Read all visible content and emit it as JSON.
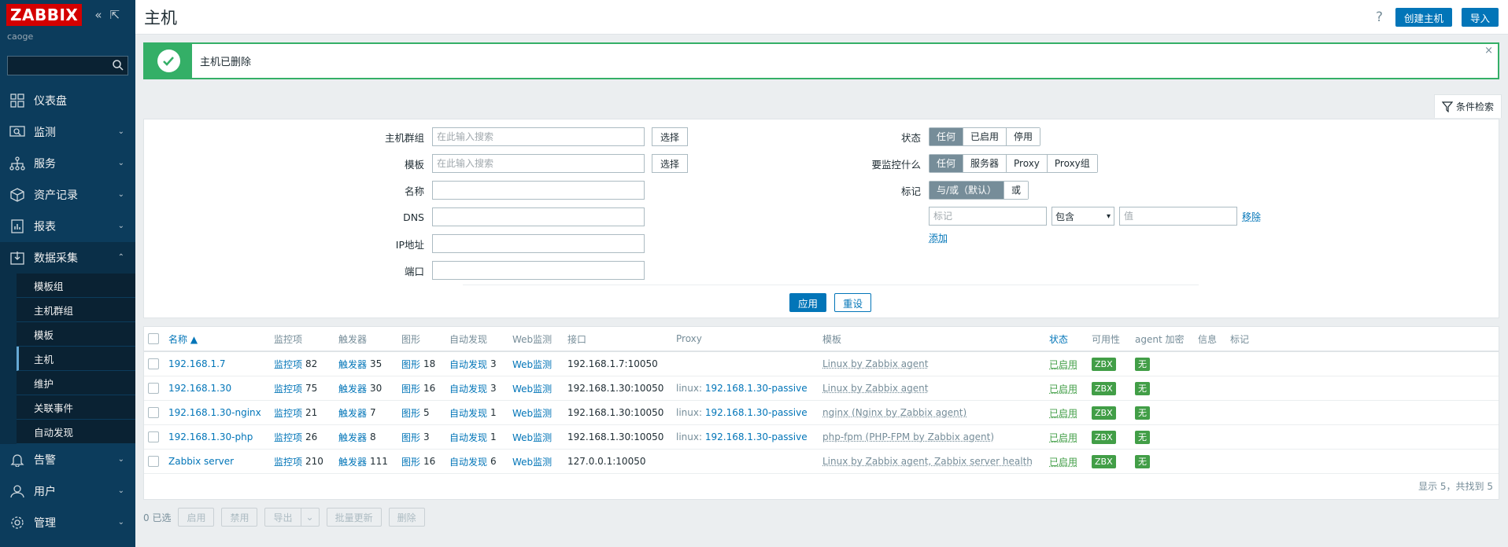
{
  "app": {
    "logo": "ZABBIX",
    "server_name": "caoge"
  },
  "sidebar": {
    "items": [
      {
        "label": "仪表盘",
        "icon": "dashboard-icon"
      },
      {
        "label": "监测",
        "icon": "monitoring-icon"
      },
      {
        "label": "服务",
        "icon": "services-icon"
      },
      {
        "label": "资产记录",
        "icon": "inventory-icon"
      },
      {
        "label": "报表",
        "icon": "reports-icon"
      },
      {
        "label": "数据采集",
        "icon": "data-collection-icon"
      },
      {
        "label": "告警",
        "icon": "alerts-icon"
      },
      {
        "label": "用户",
        "icon": "users-icon"
      },
      {
        "label": "管理",
        "icon": "administration-icon"
      }
    ],
    "submenu": [
      "模板组",
      "主机群组",
      "模板",
      "主机",
      "维护",
      "关联事件",
      "自动发现"
    ],
    "active_sub": "主机"
  },
  "header": {
    "title": "主机",
    "help": "?",
    "create_label": "创建主机",
    "import_label": "导入"
  },
  "alert": {
    "message": "主机已删除",
    "close": "×"
  },
  "filter": {
    "tab_label": "条件检索",
    "host_group_label": "主机群组",
    "template_label": "模板",
    "name_label": "名称",
    "dns_label": "DNS",
    "ip_label": "IP地址",
    "port_label": "端口",
    "placeholder": "在此输入搜索",
    "select_label": "选择",
    "status_label": "状态",
    "status_options": [
      "任何",
      "已启用",
      "停用"
    ],
    "monitored_by_label": "要监控什么",
    "monitored_by_options": [
      "任何",
      "服务器",
      "Proxy",
      "Proxy组"
    ],
    "tags_label": "标记",
    "tags_options": [
      "与/或（默认）",
      "或"
    ],
    "tag_placeholder": "标记",
    "tag_operator": "包含",
    "value_placeholder": "值",
    "remove_label": "移除",
    "add_label": "添加",
    "apply_label": "应用",
    "reset_label": "重设"
  },
  "table": {
    "headers": {
      "name": "名称 ▲",
      "items": "监控项",
      "triggers": "触发器",
      "graphs": "图形",
      "discovery": "自动发现",
      "web": "Web监测",
      "interface": "接口",
      "proxy": "Proxy",
      "templates": "模板",
      "status": "状态",
      "availability": "可用性",
      "agent_encryption": "agent 加密",
      "info": "信息",
      "tags": "标记"
    },
    "rows": [
      {
        "name": "192.168.1.7",
        "items_label": "监控项",
        "items": "82",
        "triggers_label": "触发器",
        "triggers": "35",
        "graphs_label": "图形",
        "graphs": "18",
        "discovery_label": "自动发现",
        "discovery": "3",
        "web": "Web监测",
        "interface": "192.168.1.7:10050",
        "proxy_prefix": "",
        "proxy": "",
        "templates": "Linux by Zabbix agent",
        "status": "已启用",
        "availability": "ZBX",
        "encryption": "无"
      },
      {
        "name": "192.168.1.30",
        "items_label": "监控项",
        "items": "75",
        "triggers_label": "触发器",
        "triggers": "30",
        "graphs_label": "图形",
        "graphs": "16",
        "discovery_label": "自动发现",
        "discovery": "3",
        "web": "Web监测",
        "interface": "192.168.1.30:10050",
        "proxy_prefix": "linux: ",
        "proxy": "192.168.1.30-passive",
        "templates": "Linux by Zabbix agent",
        "status": "已启用",
        "availability": "ZBX",
        "encryption": "无"
      },
      {
        "name": "192.168.1.30-nginx",
        "items_label": "监控项",
        "items": "21",
        "triggers_label": "触发器",
        "triggers": "7",
        "graphs_label": "图形",
        "graphs": "5",
        "discovery_label": "自动发现",
        "discovery": "1",
        "web": "Web监测",
        "interface": "192.168.1.30:10050",
        "proxy_prefix": "linux: ",
        "proxy": "192.168.1.30-passive",
        "templates": "nginx (Nginx by Zabbix agent)",
        "status": "已启用",
        "availability": "ZBX",
        "encryption": "无"
      },
      {
        "name": "192.168.1.30-php",
        "items_label": "监控项",
        "items": "26",
        "triggers_label": "触发器",
        "triggers": "8",
        "graphs_label": "图形",
        "graphs": "3",
        "discovery_label": "自动发现",
        "discovery": "1",
        "web": "Web监测",
        "interface": "192.168.1.30:10050",
        "proxy_prefix": "linux: ",
        "proxy": "192.168.1.30-passive",
        "templates": "php-fpm (PHP-FPM by Zabbix agent)",
        "status": "已启用",
        "availability": "ZBX",
        "encryption": "无"
      },
      {
        "name": "Zabbix server",
        "items_label": "监控项",
        "items": "210",
        "triggers_label": "触发器",
        "triggers": "111",
        "graphs_label": "图形",
        "graphs": "16",
        "discovery_label": "自动发现",
        "discovery": "6",
        "web": "Web监测",
        "interface": "127.0.0.1:10050",
        "proxy_prefix": "",
        "proxy": "",
        "templates": "Linux by Zabbix agent, Zabbix server health",
        "status": "已启用",
        "availability": "ZBX",
        "encryption": "无"
      }
    ],
    "footer": "显示 5，共找到 5"
  },
  "actions": {
    "selected": "0 已选",
    "enable": "启用",
    "disable": "禁用",
    "export": "导出",
    "mass_update": "批量更新",
    "delete": "删除"
  },
  "colors": {
    "sidebar_bg": "#0c3c5c",
    "accent": "#0275b8",
    "success": "#34af67",
    "status_green": "#429e47",
    "logo_red": "#d40000"
  }
}
